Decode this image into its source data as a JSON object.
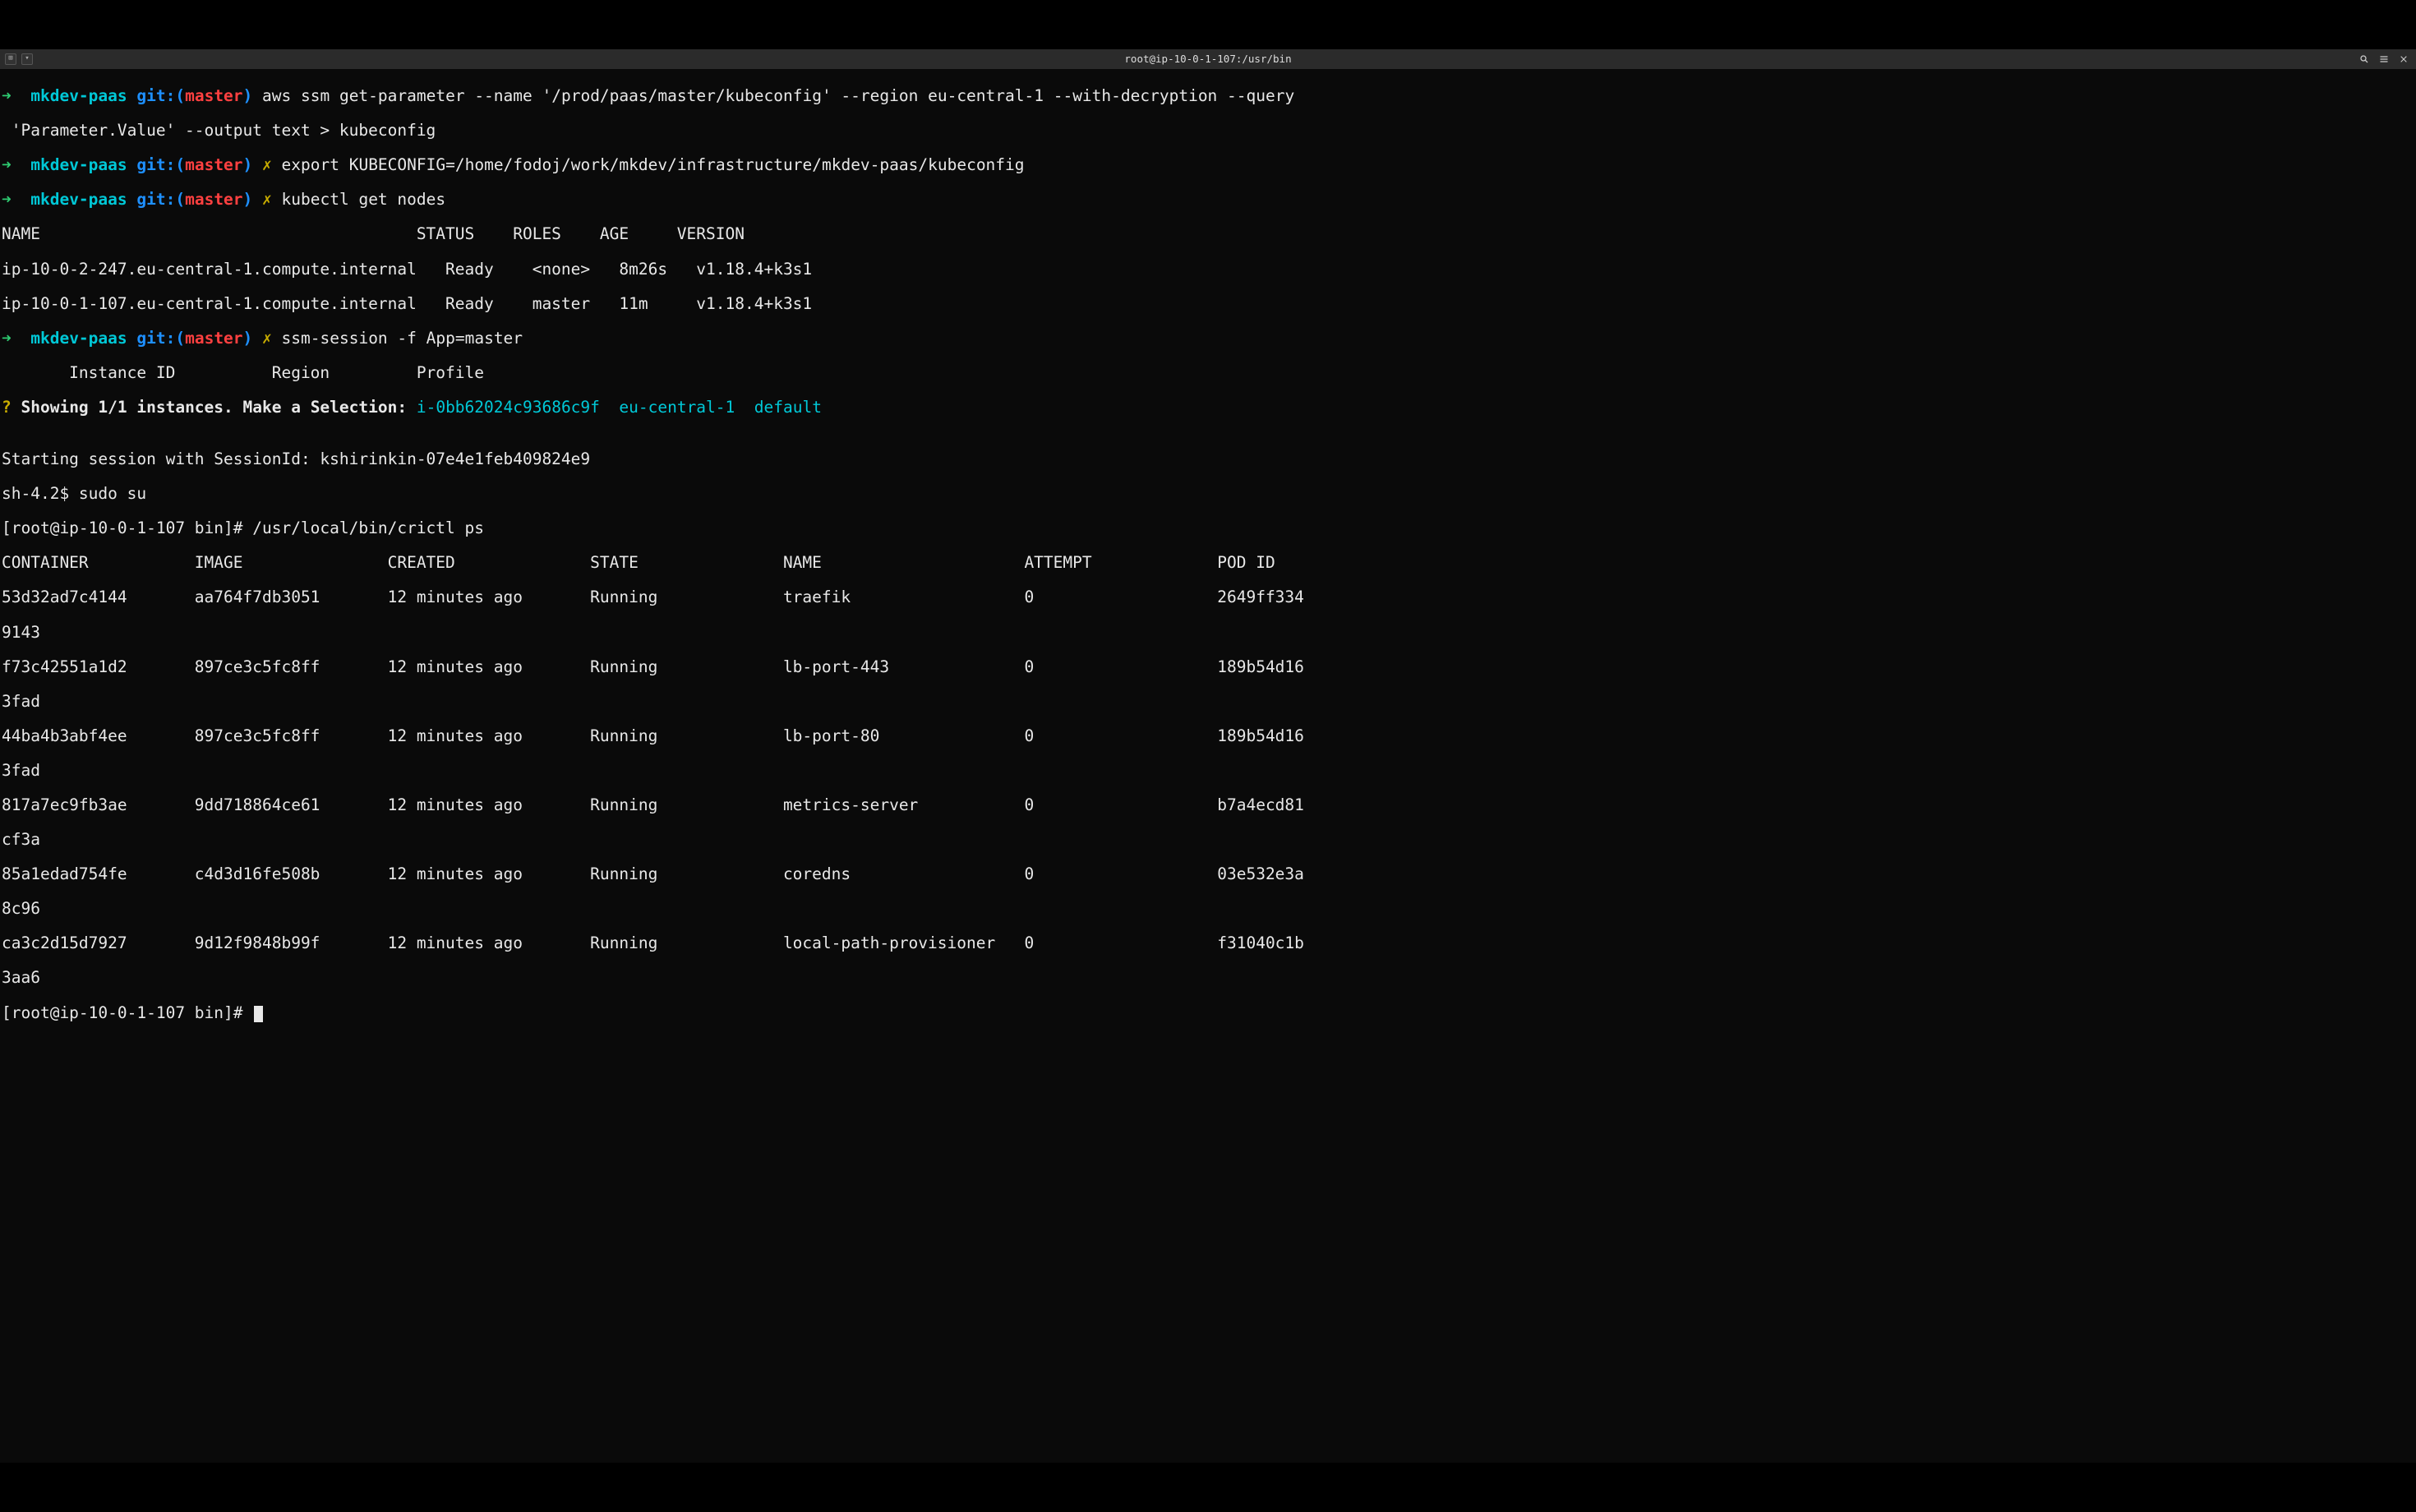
{
  "titlebar": {
    "title": "root@ip-10-0-1-107:/usr/bin",
    "new_tab": "⊞",
    "dropdown": "▾",
    "search_label": "Search",
    "menu_label": "Menu",
    "close_label": "Close"
  },
  "prompt": {
    "arrow": "➜",
    "dir": "mkdev-paas",
    "git_pre": "git:(",
    "git_branch": "master",
    "git_post": ")",
    "dirty": "✗"
  },
  "commands": {
    "c1a": " aws ssm get-parameter --name '/prod/paas/master/kubeconfig' --region eu-central-1 --with-decryption --query",
    "c1b": " 'Parameter.Value' --output text > kubeconfig",
    "c2": " export KUBECONFIG=/home/fodoj/work/mkdev/infrastructure/mkdev-paas/kubeconfig",
    "c3": " kubectl get nodes",
    "c4": " ssm-session -f App=master"
  },
  "kubectl": {
    "header": "NAME                                       STATUS    ROLES    AGE     VERSION",
    "row1": "ip-10-0-2-247.eu-central-1.compute.internal   Ready    <none>   8m26s   v1.18.4+k3s1",
    "row2": "ip-10-0-1-107.eu-central-1.compute.internal   Ready    master   11m     v1.18.4+k3s1"
  },
  "ssm": {
    "tbl_header": "       Instance ID          Region         Profile",
    "q_mark": "?",
    "q_text": " Showing 1/1 instances. Make a Selection: ",
    "instance": "i-0bb62024c93686c9f",
    "gap1": "  ",
    "region": "eu-central-1",
    "gap2": "  ",
    "profile": "default",
    "blank": "",
    "start": "Starting session with SessionId: kshirinkin-07e4e1feb409824e9",
    "sh": "sh-4.2$ sudo su",
    "rootp1": "[root@ip-10-0-1-107 bin]# /usr/local/bin/crictl ps",
    "rootp2": "[root@ip-10-0-1-107 bin]# "
  },
  "crictl": {
    "header": "CONTAINER           IMAGE               CREATED              STATE               NAME                     ATTEMPT             POD ID",
    "rows": [
      "53d32ad7c4144       aa764f7db3051       12 minutes ago       Running             traefik                  0                   2649ff334",
      "9143",
      "f73c42551a1d2       897ce3c5fc8ff       12 minutes ago       Running             lb-port-443              0                   189b54d16",
      "3fad",
      "44ba4b3abf4ee       897ce3c5fc8ff       12 minutes ago       Running             lb-port-80               0                   189b54d16",
      "3fad",
      "817a7ec9fb3ae       9dd718864ce61       12 minutes ago       Running             metrics-server           0                   b7a4ecd81",
      "cf3a",
      "85a1edad754fe       c4d3d16fe508b       12 minutes ago       Running             coredns                  0                   03e532e3a",
      "8c96",
      "ca3c2d15d7927       9d12f9848b99f       12 minutes ago       Running             local-path-provisioner   0                   f31040c1b",
      "3aa6"
    ]
  }
}
